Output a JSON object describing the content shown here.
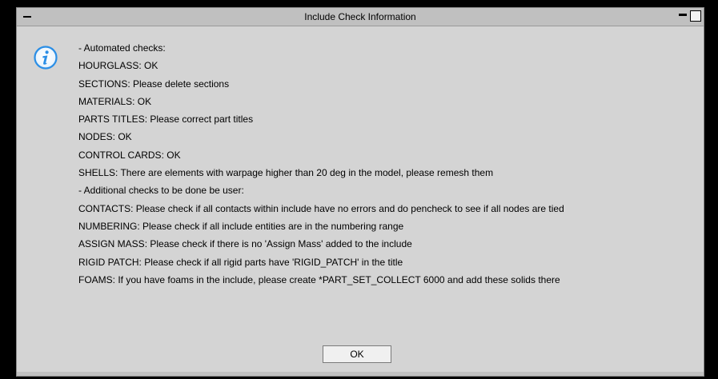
{
  "window": {
    "title": "Include Check Information"
  },
  "message": {
    "icon": "info-icon",
    "lines": [
      "- Automated checks:",
      "HOURGLASS: OK",
      "SECTIONS: Please delete sections",
      "MATERIALS: OK",
      "PARTS TITLES: Please correct part titles",
      "NODES: OK",
      "CONTROL CARDS: OK",
      "SHELLS: There are elements with warpage higher than 20 deg in the model, please remesh them",
      "- Additional checks to be done be user:",
      "CONTACTS: Please check if all contacts within include have no errors and do pencheck to see if all nodes are tied",
      "NUMBERING: Please check if all include entities are in the numbering range",
      "ASSIGN MASS: Please check if there is no 'Assign Mass' added to the include",
      "RIGID PATCH: Please check if all rigid parts have 'RIGID_PATCH' in the title",
      "FOAMS: If you have foams in the include, please create *PART_SET_COLLECT 6000 and add these solids there"
    ]
  },
  "buttons": {
    "ok_label": "OK"
  },
  "colors": {
    "window_bg": "#c0c0c0",
    "content_bg": "#d4d4d4",
    "icon_blue": "#2a8ee6"
  }
}
